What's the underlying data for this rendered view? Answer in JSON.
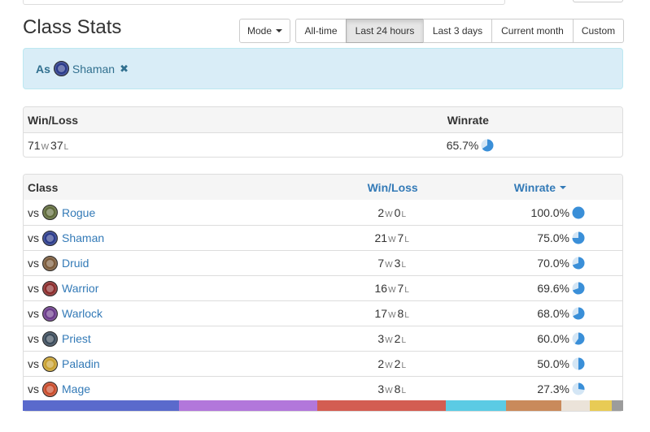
{
  "header": {
    "title": "Class Stats",
    "mode_label": "Mode",
    "ranges": [
      {
        "label": "All-time",
        "active": false
      },
      {
        "label": "Last 24 hours",
        "active": true
      },
      {
        "label": "Last 3 days",
        "active": false
      },
      {
        "label": "Current month",
        "active": false
      },
      {
        "label": "Custom",
        "active": false
      }
    ]
  },
  "filter": {
    "prefix": "As",
    "class": "Shaman",
    "class_color": "#2a3a8a",
    "remove_icon": "✖"
  },
  "summary": {
    "col_winloss": "Win/Loss",
    "col_winrate": "Winrate",
    "wins": "71",
    "win_suffix": "W",
    "losses": "37",
    "loss_suffix": "L",
    "winrate_text": "65.7%",
    "winrate": 0.657
  },
  "matchups": {
    "col_class": "Class",
    "col_winloss": "Win/Loss",
    "col_winrate": "Winrate",
    "vs_label": "vs",
    "win_suffix": "W",
    "loss_suffix": "L",
    "rows": [
      {
        "class": "Rogue",
        "wins": "2",
        "losses": "0",
        "winrate_text": "100.0%",
        "winrate": 1.0,
        "icon_color": "#5e6a3a"
      },
      {
        "class": "Shaman",
        "wins": "21",
        "losses": "7",
        "winrate_text": "75.0%",
        "winrate": 0.75,
        "icon_color": "#2a3a8a"
      },
      {
        "class": "Druid",
        "wins": "7",
        "losses": "3",
        "winrate_text": "70.0%",
        "winrate": 0.7,
        "icon_color": "#7a5a3a"
      },
      {
        "class": "Warrior",
        "wins": "16",
        "losses": "7",
        "winrate_text": "69.6%",
        "winrate": 0.696,
        "icon_color": "#8a2a2a"
      },
      {
        "class": "Warlock",
        "wins": "17",
        "losses": "8",
        "winrate_text": "68.0%",
        "winrate": 0.68,
        "icon_color": "#6a3a8a"
      },
      {
        "class": "Priest",
        "wins": "3",
        "losses": "2",
        "winrate_text": "60.0%",
        "winrate": 0.6,
        "icon_color": "#3a4a5a"
      },
      {
        "class": "Paladin",
        "wins": "2",
        "losses": "2",
        "winrate_text": "50.0%",
        "winrate": 0.5,
        "icon_color": "#c8a030"
      },
      {
        "class": "Mage",
        "wins": "3",
        "losses": "8",
        "winrate_text": "27.3%",
        "winrate": 0.273,
        "icon_color": "#c84a2a"
      }
    ]
  },
  "distribution_bar": [
    {
      "color": "#5a6acc",
      "share": 0.26
    },
    {
      "color": "#b277db",
      "share": 0.231
    },
    {
      "color": "#d35d52",
      "share": 0.213
    },
    {
      "color": "#5bcbe4",
      "share": 0.101
    },
    {
      "color": "#c98a5b",
      "share": 0.092
    },
    {
      "color": "#ebe3d9",
      "share": 0.047
    },
    {
      "color": "#e8cb55",
      "share": 0.037
    },
    {
      "color": "#9c9c9c",
      "share": 0.019
    }
  ],
  "colors": {
    "link": "#337ab7",
    "pie_fill": "#3a8fd8",
    "pie_bg": "#d4e6f5",
    "alert_bg": "#d9edf7"
  }
}
